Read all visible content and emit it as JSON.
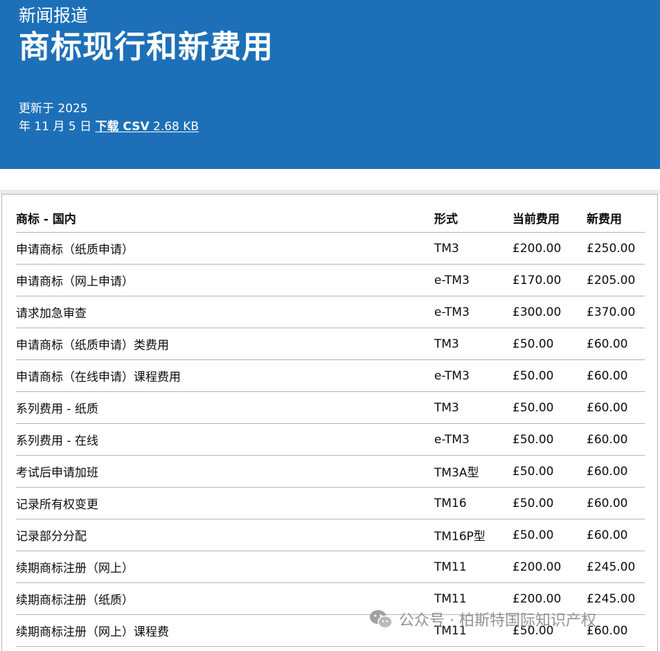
{
  "header": {
    "kicker": "新闻报道",
    "title": "商标现行和新费用",
    "updated_prefix": "更新于 2025",
    "updated_date": "年 11 月 5 日",
    "download_label": "下载 CSV",
    "file_size": "2.68 KB"
  },
  "table": {
    "headers": [
      "商标 - 国内",
      "形式",
      "当前费用",
      "新费用"
    ],
    "rows": [
      [
        "申请商标（纸质申请）",
        "TM3",
        "£200.00",
        "£250.00"
      ],
      [
        "申请商标（网上申请）",
        "e-TM3",
        "£170.00",
        "£205.00"
      ],
      [
        "请求加急审查",
        "e-TM3",
        "£300.00",
        "£370.00"
      ],
      [
        "申请商标（纸质申请）类费用",
        "TM3",
        "£50.00",
        "£60.00"
      ],
      [
        "申请商标（在线申请）课程费用",
        "e-TM3",
        "£50.00",
        "£60.00"
      ],
      [
        "系列费用 - 纸质",
        "TM3",
        "£50.00",
        "£60.00"
      ],
      [
        "系列费用 - 在线",
        "e-TM3",
        "£50.00",
        "£60.00"
      ],
      [
        "考试后申请加班",
        "TM3A型",
        "£50.00",
        "£60.00"
      ],
      [
        "记录所有权变更",
        "TM16",
        "£50.00",
        "£60.00"
      ],
      [
        "记录部分分配",
        "TM16P型",
        "£50.00",
        "£60.00"
      ],
      [
        "续期商标注册（网上）",
        "TM11",
        "£200.00",
        "£245.00"
      ],
      [
        "续期商标注册（纸质）",
        "TM11",
        "£200.00",
        "£245.00"
      ],
      [
        "续期商标注册（网上）课程费",
        "TM11",
        "£50.00",
        "£60.00"
      ]
    ]
  },
  "watermark": {
    "icon": "wechat-icon",
    "text": "公众号 · 柏斯特国际知识产权"
  },
  "colors": {
    "header_bg": "#1d70b8",
    "header_text": "#ffffff",
    "row_border": "#b1b4b6",
    "watermark": "#8a8a8a"
  }
}
